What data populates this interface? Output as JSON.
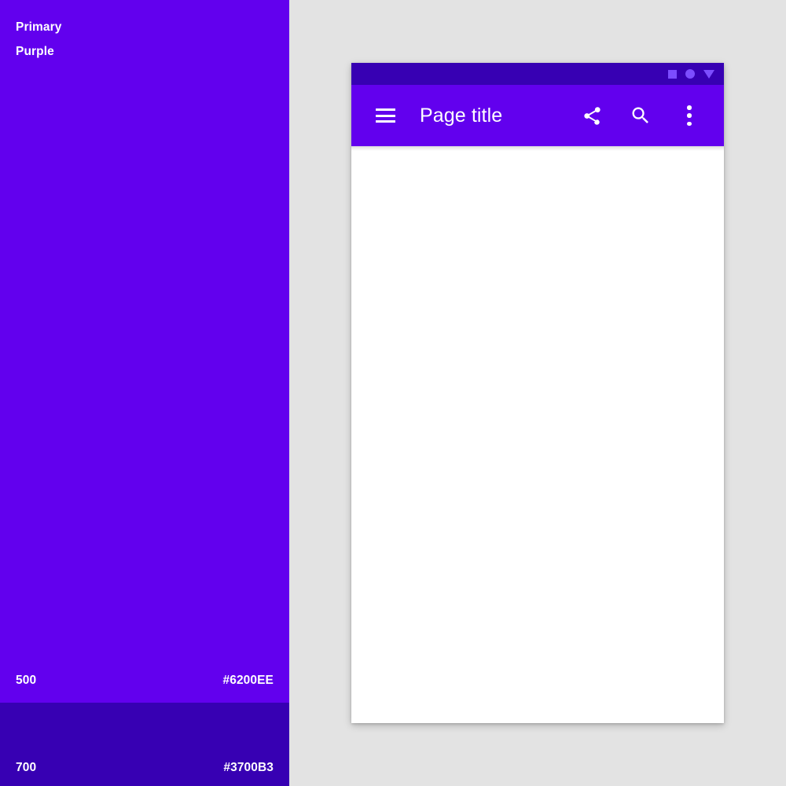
{
  "palette": {
    "name_line1": "Primary",
    "name_line2": "Purple",
    "swatches": [
      {
        "tone": "500",
        "hex": "#6200EE",
        "color": "#6200EE"
      },
      {
        "tone": "700",
        "hex": "#3700B3",
        "color": "#3700B3"
      }
    ]
  },
  "stage": {
    "background": "#E3E3E3"
  },
  "device": {
    "status_bar": {
      "background": "#3700B3",
      "icon_color": "#7C4DFF",
      "icons": [
        "square-icon",
        "circle-icon",
        "triangle-down-icon"
      ]
    },
    "app_bar": {
      "background": "#6200EE",
      "title": "Page title",
      "navigation_icon": "menu-icon",
      "actions": [
        {
          "icon": "share-icon",
          "label": "Share"
        },
        {
          "icon": "search-icon",
          "label": "Search"
        },
        {
          "icon": "more-vert-icon",
          "label": "More options"
        }
      ]
    },
    "content": {
      "background": "#FFFFFF",
      "body_text": ""
    }
  }
}
